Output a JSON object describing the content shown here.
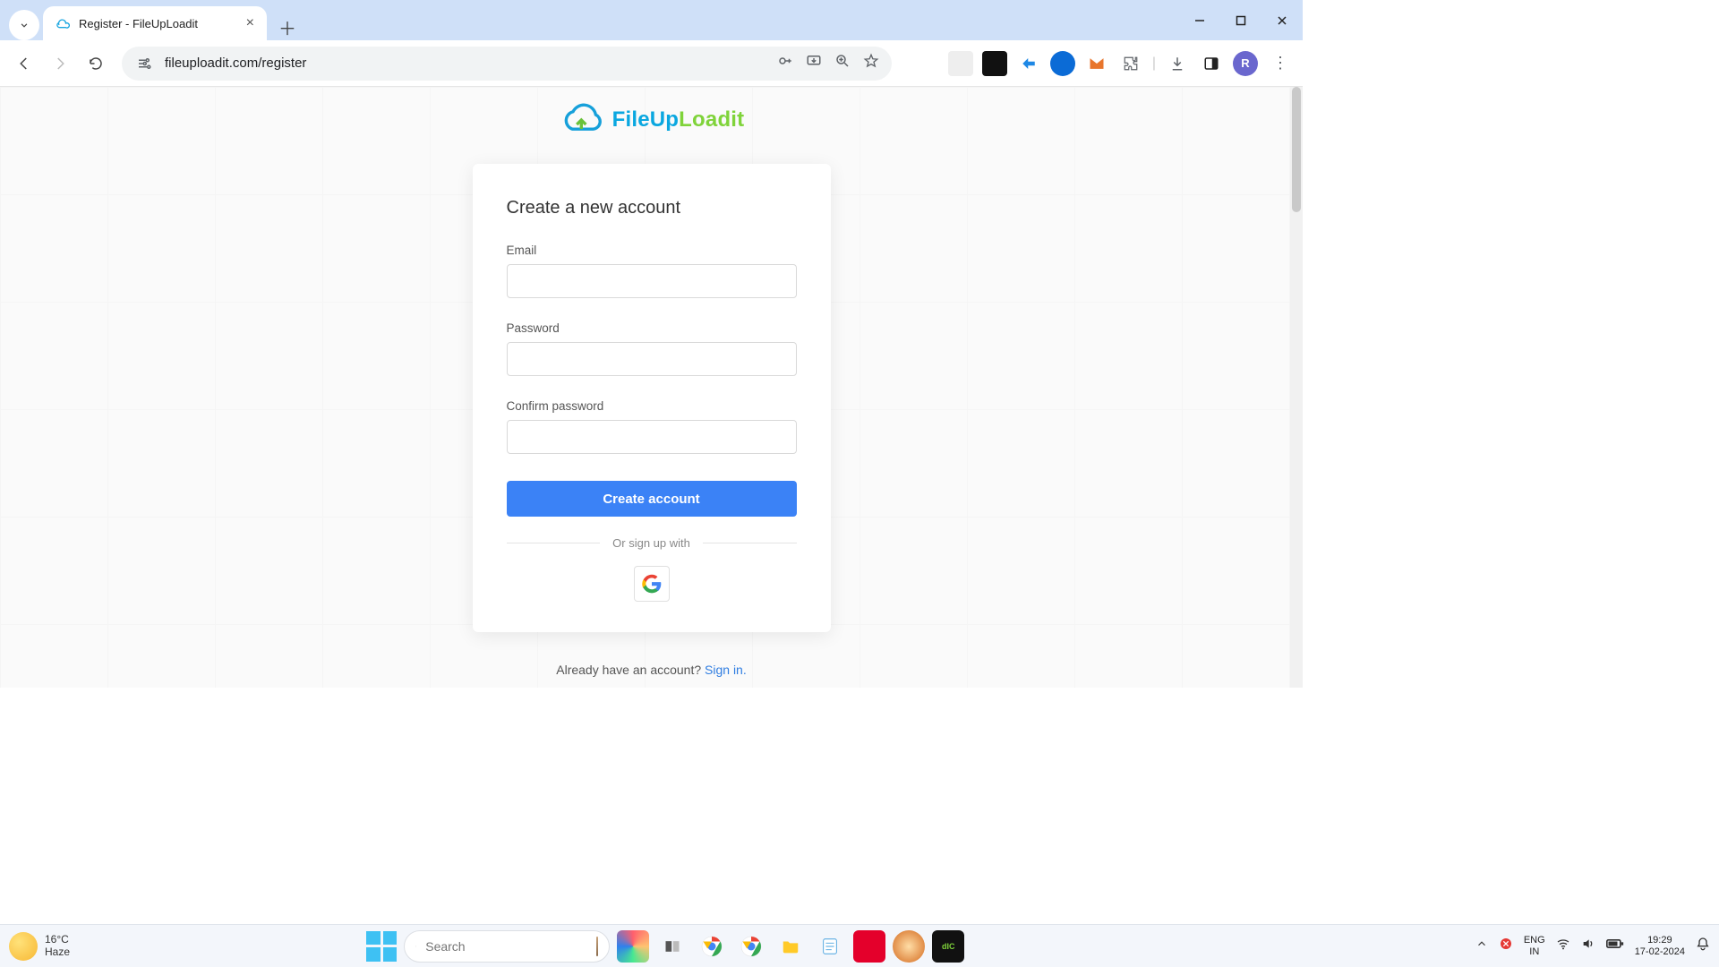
{
  "browser": {
    "tab_title": "Register - FileUpLoadit",
    "url": "fileuploadit.com/register",
    "profile_initial": "R"
  },
  "logo": {
    "part1": "FileUp",
    "part2": "Loadit"
  },
  "form": {
    "heading": "Create a new account",
    "email_label": "Email",
    "email_value": "",
    "password_label": "Password",
    "password_value": "",
    "confirm_label": "Confirm password",
    "confirm_value": "",
    "submit_label": "Create account",
    "divider_text": "Or sign up with"
  },
  "below": {
    "prompt": "Already have an account? ",
    "link": "Sign in."
  },
  "taskbar": {
    "weather_temp": "16°C",
    "weather_cond": "Haze",
    "search_placeholder": "Search",
    "lang1": "ENG",
    "lang2": "IN",
    "time": "19:29",
    "date": "17-02-2024"
  }
}
